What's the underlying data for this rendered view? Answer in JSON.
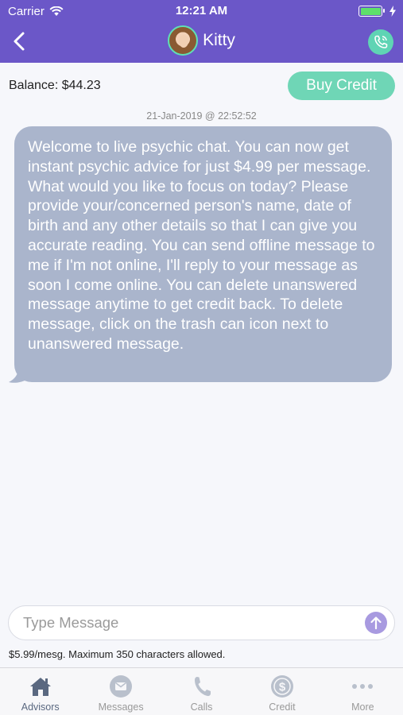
{
  "status_bar": {
    "carrier": "Carrier",
    "time": "12:21 AM",
    "battery_level": 1.0
  },
  "header": {
    "back_icon": "chevron-left-icon",
    "title": "Kitty",
    "call_icon": "phone-icon",
    "colors": {
      "bar": "#6b57c8",
      "accent": "#5fd4b4"
    }
  },
  "balance": {
    "text": "Balance: $44.23",
    "buy_label": "Buy Credit"
  },
  "chat": {
    "timestamp": "21-Jan-2019 @ 22:52:52",
    "message": "Welcome to live psychic chat. You can now get instant psychic advice for just $4.99 per message. What would you like to focus on today? Please provide your/concerned person's name, date of birth and any other details so that I can give you accurate reading. You can send offline message to me if I'm not online, I'll reply to your message as soon I come online. You can delete unanswered message anytime to get credit back. To delete message, click on the trash can icon next to unanswered message."
  },
  "composer": {
    "placeholder": "Type Message",
    "value": "",
    "send_icon": "arrow-up-icon",
    "hint": "$5.99/mesg.  Maximum 350 characters allowed."
  },
  "tabs": [
    {
      "label": "Advisors",
      "icon": "house-icon",
      "active": true
    },
    {
      "label": "Messages",
      "icon": "envelope-icon",
      "active": false
    },
    {
      "label": "Calls",
      "icon": "phone-icon",
      "active": false
    },
    {
      "label": "Credit",
      "icon": "dollar-coin-icon",
      "active": false
    },
    {
      "label": "More",
      "icon": "more-dots-icon",
      "active": false
    }
  ]
}
